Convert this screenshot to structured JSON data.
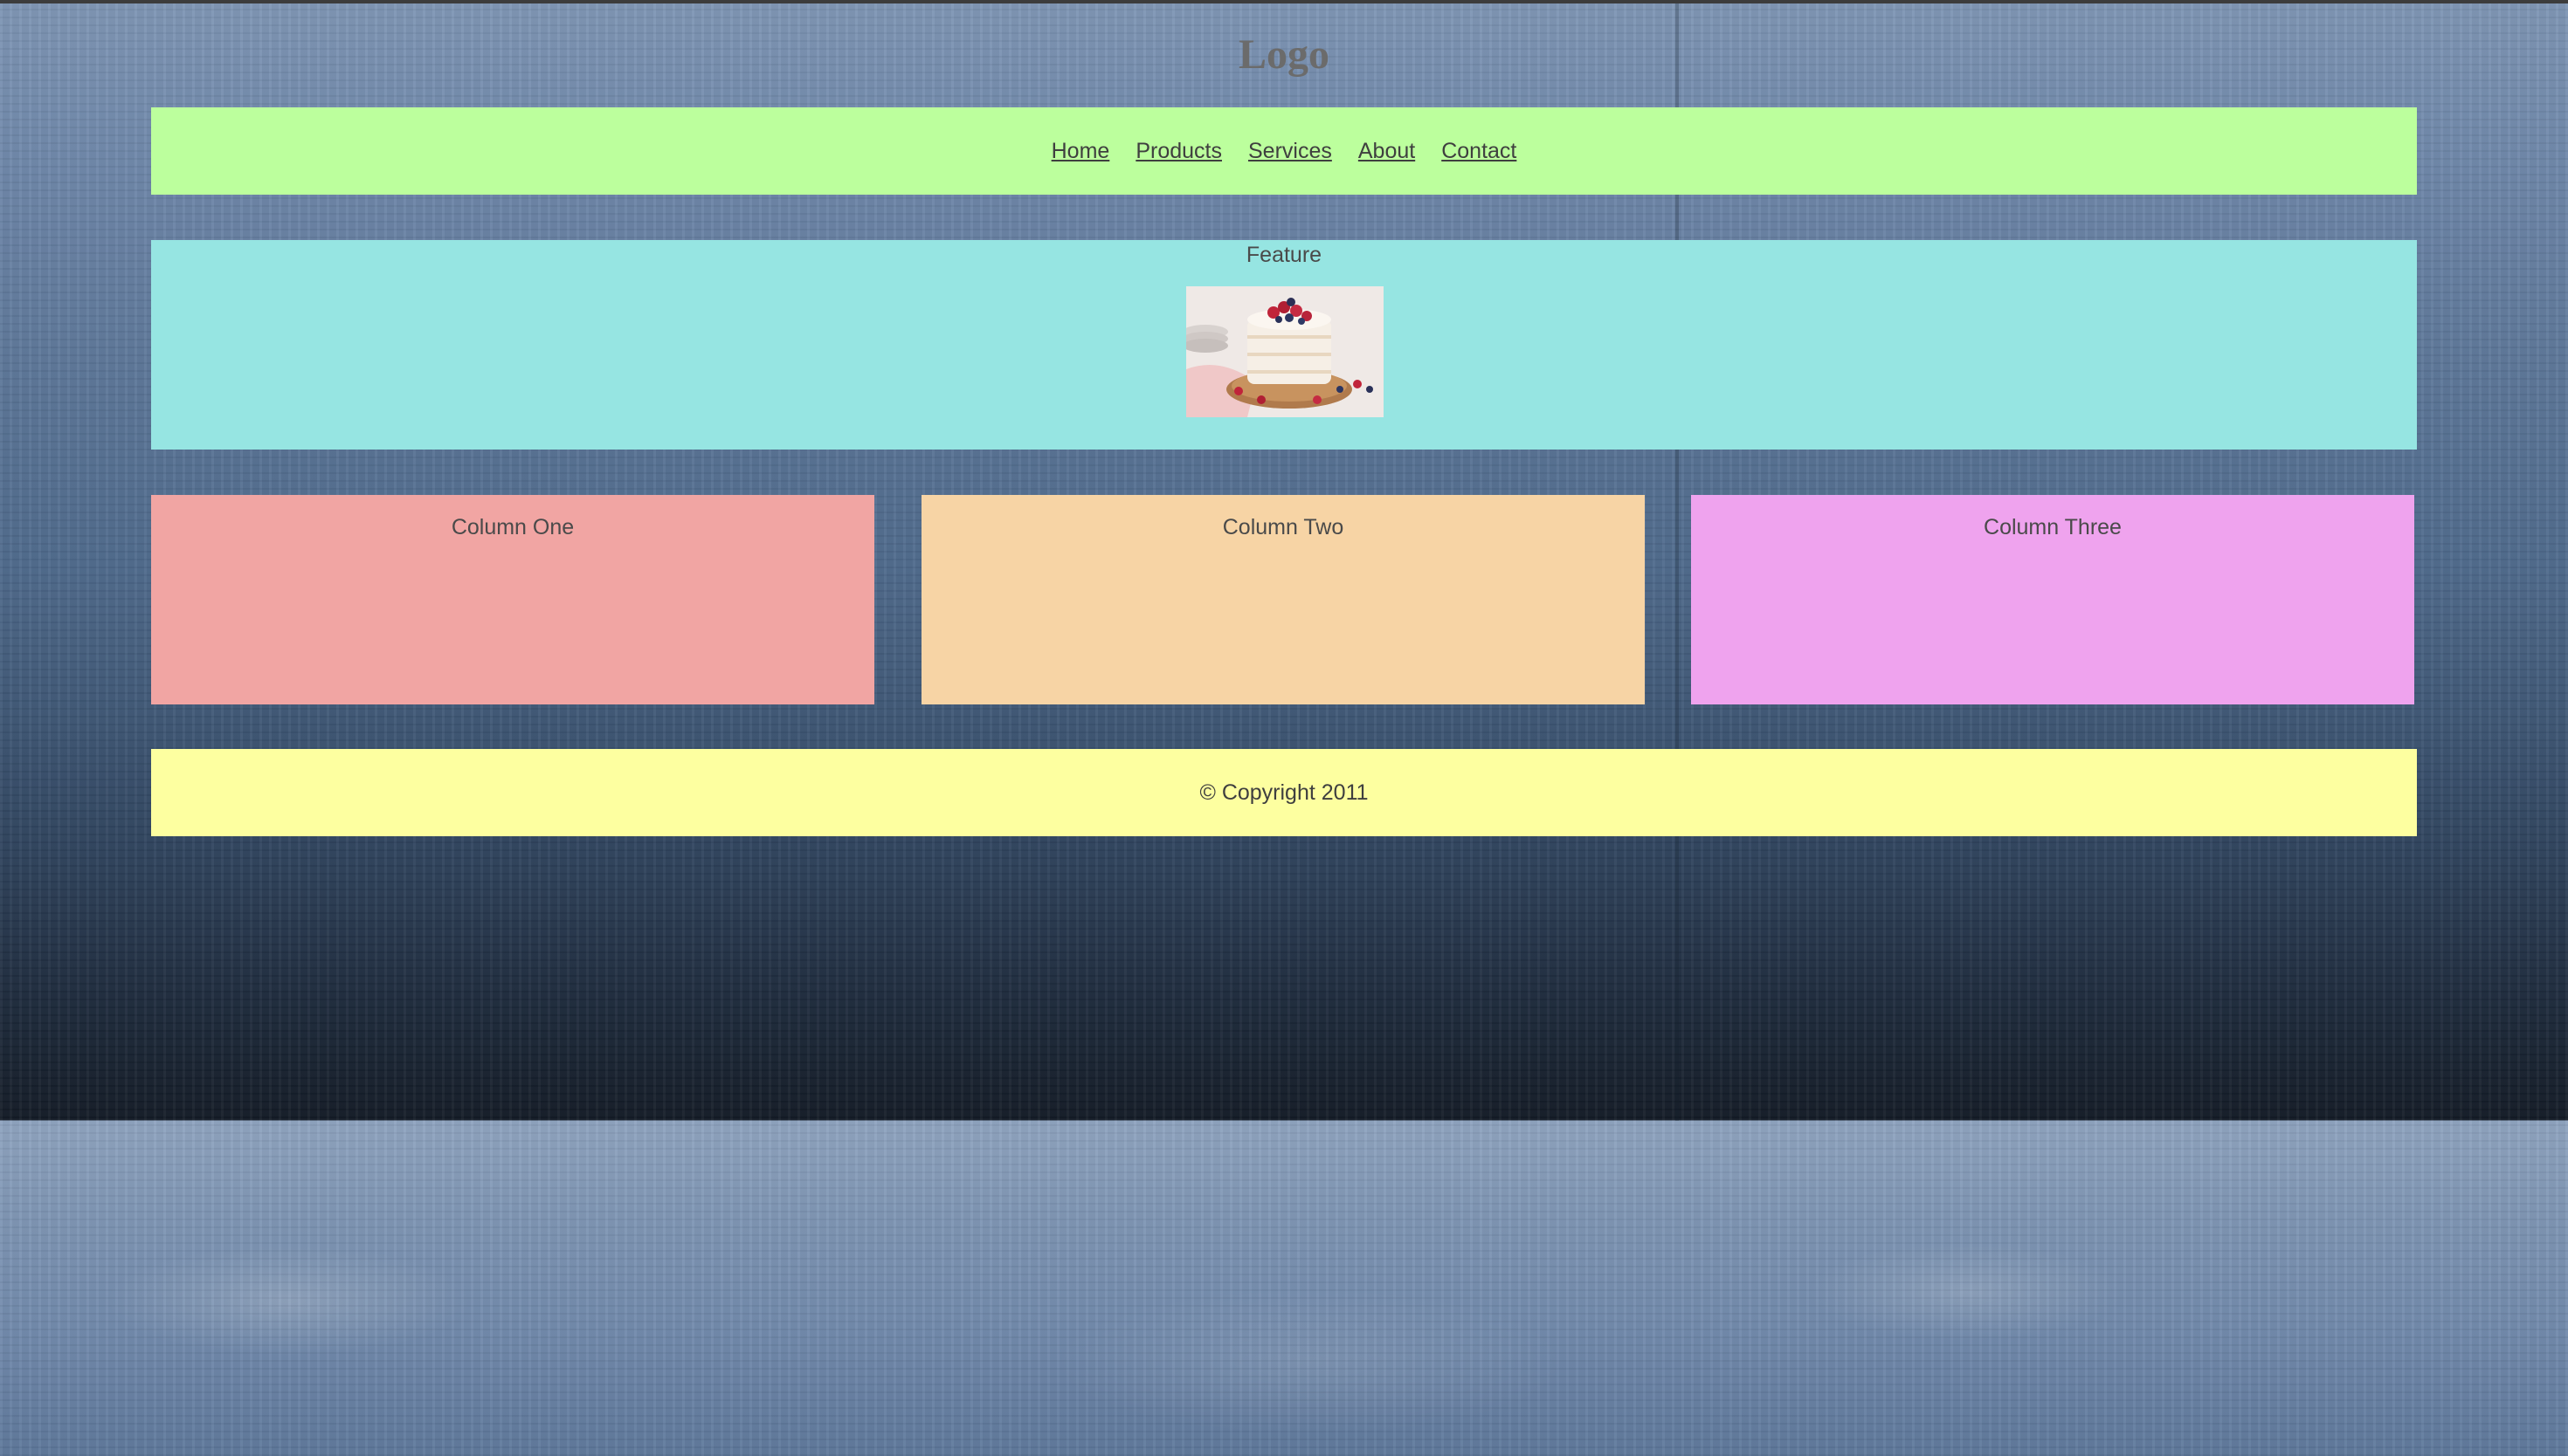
{
  "header": {
    "logo_text": "Logo"
  },
  "nav": {
    "items": [
      {
        "label": "Home"
      },
      {
        "label": "Products"
      },
      {
        "label": "Services"
      },
      {
        "label": "About"
      },
      {
        "label": "Contact"
      }
    ]
  },
  "feature": {
    "title": "Feature",
    "image_icon": "cake-image"
  },
  "columns": [
    {
      "label": "Column One"
    },
    {
      "label": "Column Two"
    },
    {
      "label": "Column Three"
    }
  ],
  "footer": {
    "copyright": "© Copyright 2011"
  },
  "colors": {
    "nav_bg": "#bcff9d",
    "feature_bg": "#96e5e2",
    "column_one_bg": "#f1a5a3",
    "column_two_bg": "#f7d4a5",
    "column_three_bg": "#efa3ee",
    "footer_bg": "#fdffa0",
    "page_bg": "#4b6686"
  }
}
